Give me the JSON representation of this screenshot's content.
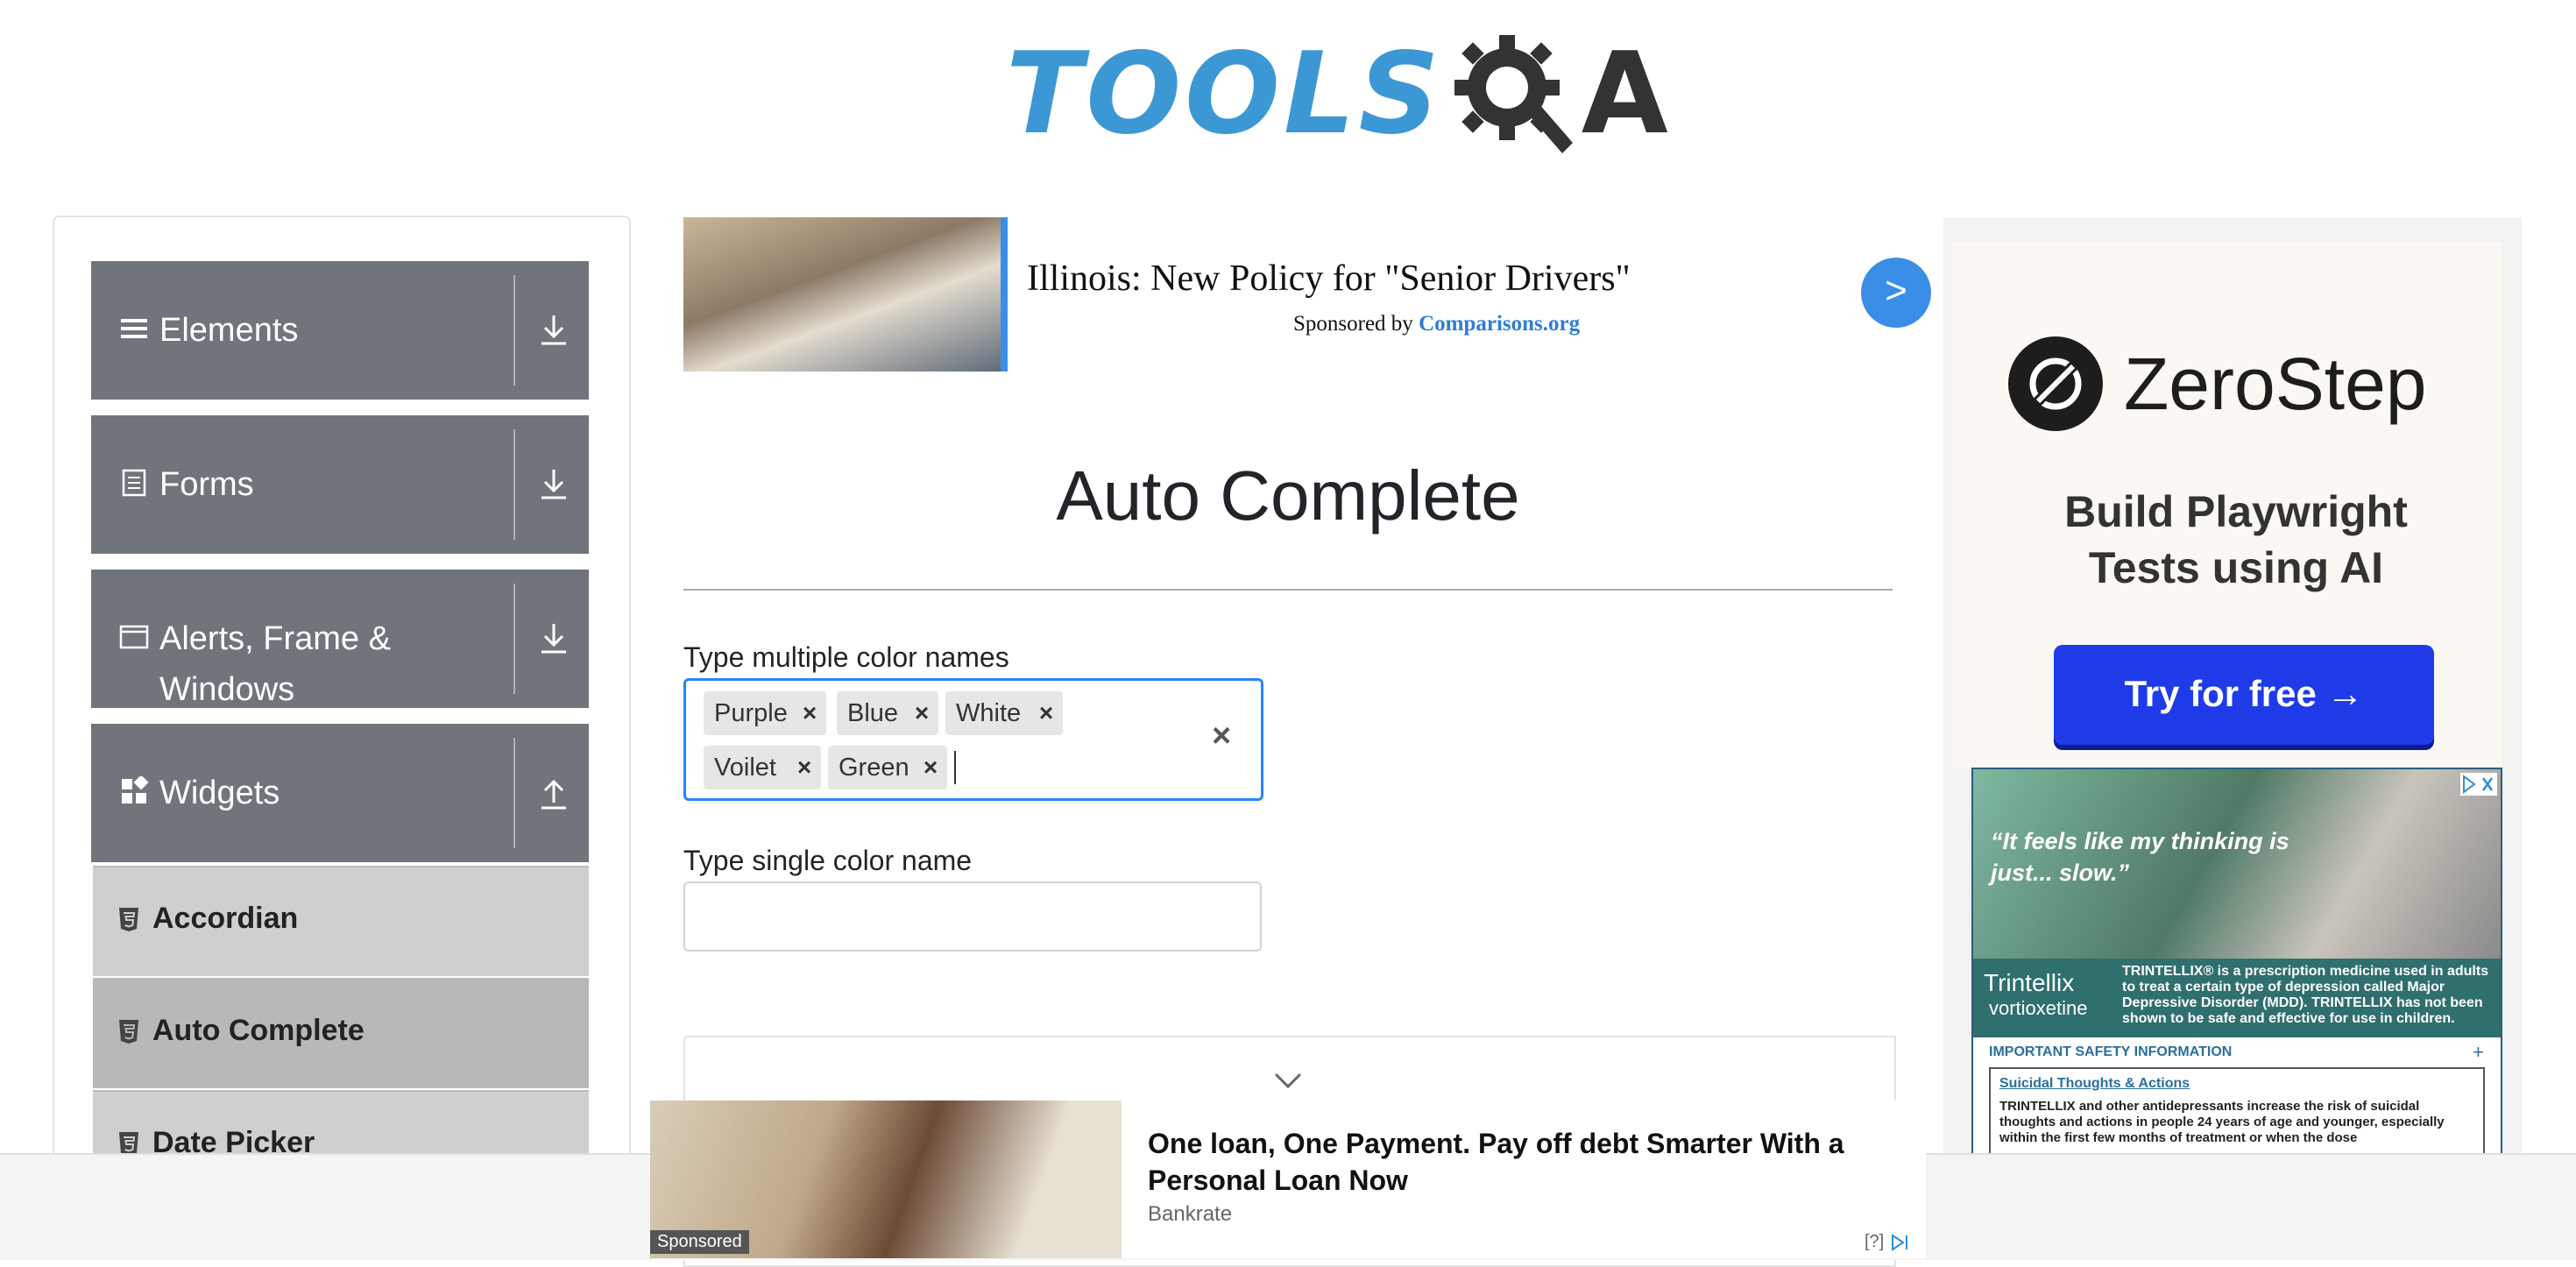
{
  "logo": {
    "text": "TOOLS",
    "suffix": "A"
  },
  "sidebar": {
    "groups": [
      {
        "label": "Elements",
        "icon": "menu-icon"
      },
      {
        "label": "Forms",
        "icon": "form-icon"
      },
      {
        "label": "Alerts, Frame &",
        "label2": "Windows",
        "icon": "window-icon"
      },
      {
        "label": "Widgets",
        "icon": "widgets-icon"
      }
    ],
    "items": [
      {
        "label": "Accordian"
      },
      {
        "label": "Auto Complete"
      },
      {
        "label": "Date Picker"
      }
    ]
  },
  "ad_top": {
    "headline": "Illinois: New Policy for \"Senior Drivers\"",
    "sponsored_prefix": "Sponsored by",
    "sponsor": "Comparisons.org",
    "go": ">"
  },
  "main": {
    "title": "Auto Complete",
    "multi_label": "Type multiple color names",
    "multi_values": [
      "Purple",
      "Blue",
      "White",
      "Voilet",
      "Green"
    ],
    "clear_symbol": "×",
    "single_label": "Type single color name",
    "single_value": ""
  },
  "ad_right": {
    "brand": "ZeroStep",
    "tagline_1": "Build Playwright",
    "tagline_2": "Tests using AI",
    "cta": "Try for free →",
    "trintellix": {
      "quote": "“It feels like my thinking is just... slow.”",
      "brand": "Trintellix",
      "brand_sub": "vortioxetine",
      "band_text": "TRINTELLIX® is a prescription medicine used in adults to treat a certain type of depression called Major Depressive Disorder (MDD). TRINTELLIX has not been shown to be safe and effective for use in children.",
      "isi": "IMPORTANT SAFETY INFORMATION",
      "plus": "+",
      "section_title": "Suicidal Thoughts & Actions",
      "section_body": "TRINTELLIX and other antidepressants increase the risk of suicidal thoughts and actions in people 24 years of age and younger, especially within the first few months of treatment or when the dose"
    }
  },
  "ad_bottom": {
    "sponsored": "Sponsored",
    "headline": "One loan, One Payment. Pay off debt Smarter With a Personal Loan Now",
    "source": "Bankrate",
    "help": "[?]"
  },
  "colors": {
    "accent": "#2684ff",
    "sidebar_group": "#70757c",
    "logo_blue": "#3c98d4"
  }
}
